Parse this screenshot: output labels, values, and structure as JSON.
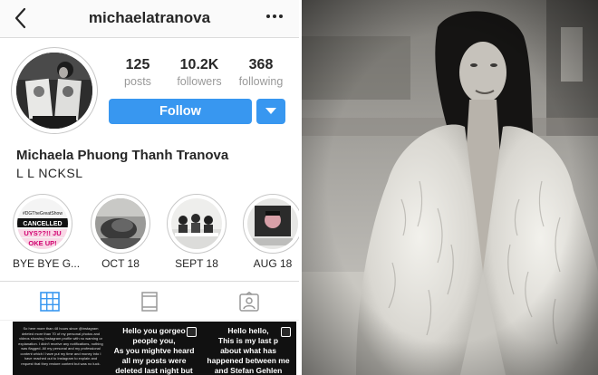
{
  "profile": {
    "username": "michaelatranova",
    "full_name": "Michaela Phuong Thanh Tranova",
    "bio": "L L NCKSL",
    "stats": {
      "posts_count": "125",
      "posts_label": "posts",
      "followers_count": "10.2K",
      "followers_label": "followers",
      "following_count": "368",
      "following_label": "following"
    },
    "follow_label": "Follow"
  },
  "highlights": [
    {
      "label": "BYE BYE G...",
      "cover_lines": [
        "#DGTheGreatShow",
        "CANCELLED",
        "UYS??!! JU",
        "OKE UP!"
      ]
    },
    {
      "label": "OCT 18"
    },
    {
      "label": "SEPT 18"
    },
    {
      "label": "AUG 18"
    }
  ],
  "tabs": [
    "grid-icon",
    "feed-icon",
    "tagged-icon"
  ],
  "posts": [
    {
      "text": "So here more than 48 hours since @instagram deleted more than 70 of my personal photos and videos showing Instagram profile with no warning or explanation. I didn't receive any notifications, nothing was flagged. All my personal and my professional content which I have put my time and money into I have reached out to Instagram to explain and request that they restore content but was no luck."
    },
    {
      "text": "Hello you gorgeo\npeople you,\nAs you mightve heard\nall my posts were\ndeleted last night but"
    },
    {
      "text": "Hello hello,\nThis is my last p\nabout what has\nhappened between me\nand Stefan Gehlen"
    }
  ],
  "colors": {
    "accent": "#3897f0",
    "text": "#262626",
    "muted": "#999999",
    "divider": "#dbdbdb",
    "tab_active": "#3897f0"
  }
}
